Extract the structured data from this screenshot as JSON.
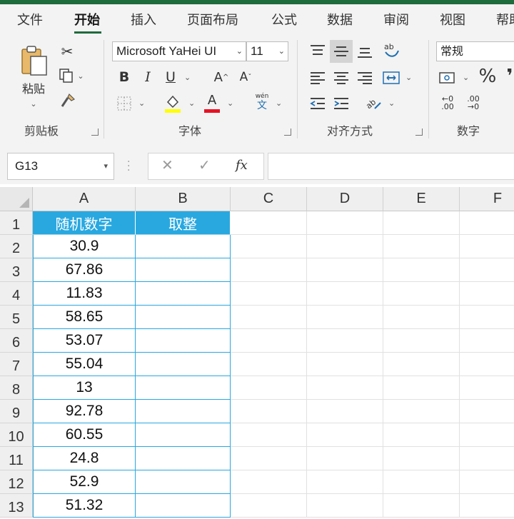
{
  "tabs": [
    "文件",
    "开始",
    "插入",
    "页面布局",
    "公式",
    "数据",
    "审阅",
    "视图",
    "帮助"
  ],
  "active_tab": "开始",
  "ribbon": {
    "clipboard": {
      "paste_label": "粘贴",
      "group_label": "剪贴板"
    },
    "font": {
      "font_name": "Microsoft YaHei UI",
      "font_size": "11",
      "group_label": "字体",
      "phonetic_top": "wén",
      "phonetic_bottom": "文",
      "font_color": "#e81123",
      "fill_color": "#ffff00"
    },
    "alignment": {
      "group_label": "对齐方式"
    },
    "number": {
      "format": "常规",
      "group_label": "数字",
      "percent": "%"
    }
  },
  "formula_bar": {
    "name_box": "G13",
    "fx": "fx",
    "formula": ""
  },
  "grid": {
    "columns": [
      "A",
      "B",
      "C",
      "D",
      "E",
      "F"
    ],
    "rows": [
      "1",
      "2",
      "3",
      "4",
      "5",
      "6",
      "7",
      "8",
      "9",
      "10",
      "11",
      "12",
      "13"
    ],
    "header_row": [
      "随机数字",
      "取整"
    ],
    "values": [
      "30.9",
      "67.86",
      "11.83",
      "58.65",
      "53.07",
      "55.04",
      "13",
      "92.78",
      "60.55",
      "24.8",
      "52.9",
      "51.32"
    ],
    "header_color": "#29a8e0"
  }
}
